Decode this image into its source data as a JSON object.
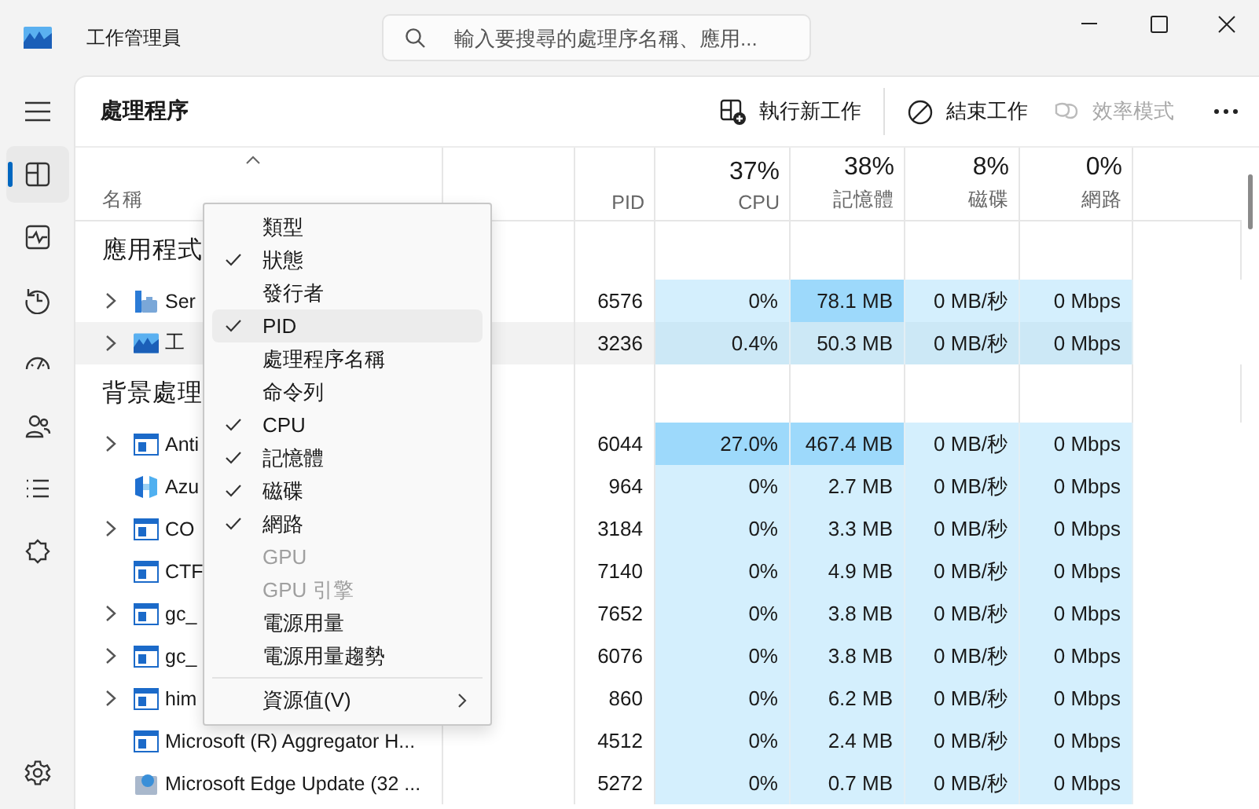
{
  "window": {
    "title": "工作管理員"
  },
  "search": {
    "placeholder": "輸入要搜尋的處理序名稱、應用..."
  },
  "nav": {
    "items": [
      {
        "selected": true
      },
      {
        "selected": false
      },
      {
        "selected": false
      },
      {
        "selected": false
      },
      {
        "selected": false
      },
      {
        "selected": false
      },
      {
        "selected": false
      }
    ]
  },
  "page": {
    "title": "處理程序"
  },
  "toolbar": [
    {
      "label": "執行新工作",
      "disabled": false
    },
    {
      "label": "結束工作",
      "disabled": false
    },
    {
      "label": "效率模式",
      "disabled": true
    }
  ],
  "name_column": {
    "label": "名稱",
    "sorted": true
  },
  "columns": [
    {
      "label": "PID"
    },
    {
      "percent": "37%",
      "label": "CPU"
    },
    {
      "percent": "38%",
      "label": "記憶體"
    },
    {
      "percent": "8%",
      "label": "磁碟"
    },
    {
      "percent": "0%",
      "label": "網路"
    }
  ],
  "groups": [
    {
      "label": "應用程式",
      "rows": [
        {
          "name": "Ser",
          "kind": "service",
          "expandable": true,
          "selected": false,
          "pid": "6576",
          "cells": [
            {
              "value": "0%",
              "hot": false
            },
            {
              "value": "78.1 MB",
              "hot": true
            },
            {
              "value": "0 MB/秒",
              "hot": false
            },
            {
              "value": "0 Mbps",
              "hot": false
            }
          ]
        },
        {
          "name": "工",
          "kind": "taskmgr",
          "expandable": true,
          "selected": true,
          "pid": "3236",
          "cells": [
            {
              "value": "0.4%",
              "hot": false
            },
            {
              "value": "50.3 MB",
              "hot": false
            },
            {
              "value": "0 MB/秒",
              "hot": false
            },
            {
              "value": "0 Mbps",
              "hot": false
            }
          ]
        }
      ]
    },
    {
      "label": "背景處理",
      "rows": [
        {
          "name": "Anti",
          "kind": "window",
          "expandable": true,
          "selected": false,
          "pid": "6044",
          "cells": [
            {
              "value": "27.0%",
              "hot": true
            },
            {
              "value": "467.4 MB",
              "hot": true
            },
            {
              "value": "0 MB/秒",
              "hot": false
            },
            {
              "value": "0 Mbps",
              "hot": false
            }
          ]
        },
        {
          "name": "Azu",
          "kind": "azure",
          "expandable": false,
          "selected": false,
          "pid": "964",
          "cells": [
            {
              "value": "0%",
              "hot": false
            },
            {
              "value": "2.7 MB",
              "hot": false
            },
            {
              "value": "0 MB/秒",
              "hot": false
            },
            {
              "value": "0 Mbps",
              "hot": false
            }
          ]
        },
        {
          "name": "CO",
          "kind": "window",
          "expandable": true,
          "selected": false,
          "pid": "3184",
          "cells": [
            {
              "value": "0%",
              "hot": false
            },
            {
              "value": "3.3 MB",
              "hot": false
            },
            {
              "value": "0 MB/秒",
              "hot": false
            },
            {
              "value": "0 Mbps",
              "hot": false
            }
          ]
        },
        {
          "name": "CTF",
          "kind": "window",
          "expandable": false,
          "selected": false,
          "pid": "7140",
          "cells": [
            {
              "value": "0%",
              "hot": false
            },
            {
              "value": "4.9 MB",
              "hot": false
            },
            {
              "value": "0 MB/秒",
              "hot": false
            },
            {
              "value": "0 Mbps",
              "hot": false
            }
          ]
        },
        {
          "name": "gc_",
          "kind": "window",
          "expandable": true,
          "selected": false,
          "pid": "7652",
          "cells": [
            {
              "value": "0%",
              "hot": false
            },
            {
              "value": "3.8 MB",
              "hot": false
            },
            {
              "value": "0 MB/秒",
              "hot": false
            },
            {
              "value": "0 Mbps",
              "hot": false
            }
          ]
        },
        {
          "name": "gc_",
          "kind": "window",
          "expandable": true,
          "selected": false,
          "pid": "6076",
          "cells": [
            {
              "value": "0%",
              "hot": false
            },
            {
              "value": "3.8 MB",
              "hot": false
            },
            {
              "value": "0 MB/秒",
              "hot": false
            },
            {
              "value": "0 Mbps",
              "hot": false
            }
          ]
        },
        {
          "name": "him",
          "kind": "window",
          "expandable": true,
          "selected": false,
          "pid": "860",
          "cells": [
            {
              "value": "0%",
              "hot": false
            },
            {
              "value": "6.2 MB",
              "hot": false
            },
            {
              "value": "0 MB/秒",
              "hot": false
            },
            {
              "value": "0 Mbps",
              "hot": false
            }
          ]
        },
        {
          "name": "Microsoft (R) Aggregator H...",
          "kind": "window",
          "expandable": false,
          "selected": false,
          "pid": "4512",
          "cells": [
            {
              "value": "0%",
              "hot": false
            },
            {
              "value": "2.4 MB",
              "hot": false
            },
            {
              "value": "0 MB/秒",
              "hot": false
            },
            {
              "value": "0 Mbps",
              "hot": false
            }
          ]
        },
        {
          "name": "Microsoft Edge Update (32 ...",
          "kind": "edge",
          "expandable": false,
          "selected": false,
          "pid": "5272",
          "cells": [
            {
              "value": "0%",
              "hot": false
            },
            {
              "value": "0.7 MB",
              "hot": false
            },
            {
              "value": "0 MB/秒",
              "hot": false
            },
            {
              "value": "0 Mbps",
              "hot": false
            }
          ]
        }
      ]
    }
  ],
  "context_menu": {
    "items": [
      {
        "kind": "toggle",
        "label": "類型",
        "checked": false,
        "disabled": false,
        "selected": false
      },
      {
        "kind": "toggle",
        "label": "狀態",
        "checked": true,
        "disabled": false,
        "selected": false
      },
      {
        "kind": "toggle",
        "label": "發行者",
        "checked": false,
        "disabled": false,
        "selected": false
      },
      {
        "kind": "toggle",
        "label": "PID",
        "checked": true,
        "disabled": false,
        "selected": true
      },
      {
        "kind": "toggle",
        "label": "處理程序名稱",
        "checked": false,
        "disabled": false,
        "selected": false
      },
      {
        "kind": "toggle",
        "label": "命令列",
        "checked": false,
        "disabled": false,
        "selected": false
      },
      {
        "kind": "toggle",
        "label": "CPU",
        "checked": true,
        "disabled": false,
        "selected": false
      },
      {
        "kind": "toggle",
        "label": "記憶體",
        "checked": true,
        "disabled": false,
        "selected": false
      },
      {
        "kind": "toggle",
        "label": "磁碟",
        "checked": true,
        "disabled": false,
        "selected": false
      },
      {
        "kind": "toggle",
        "label": "網路",
        "checked": true,
        "disabled": false,
        "selected": false
      },
      {
        "kind": "toggle",
        "label": "GPU",
        "checked": false,
        "disabled": true,
        "selected": false
      },
      {
        "kind": "toggle",
        "label": "GPU 引擎",
        "checked": false,
        "disabled": true,
        "selected": false
      },
      {
        "kind": "toggle",
        "label": "電源用量",
        "checked": false,
        "disabled": false,
        "selected": false
      },
      {
        "kind": "toggle",
        "label": "電源用量趨勢",
        "checked": false,
        "disabled": false,
        "selected": false
      },
      {
        "kind": "separator"
      },
      {
        "kind": "submenu",
        "label": "資源值(V)",
        "selected": false
      }
    ]
  }
}
